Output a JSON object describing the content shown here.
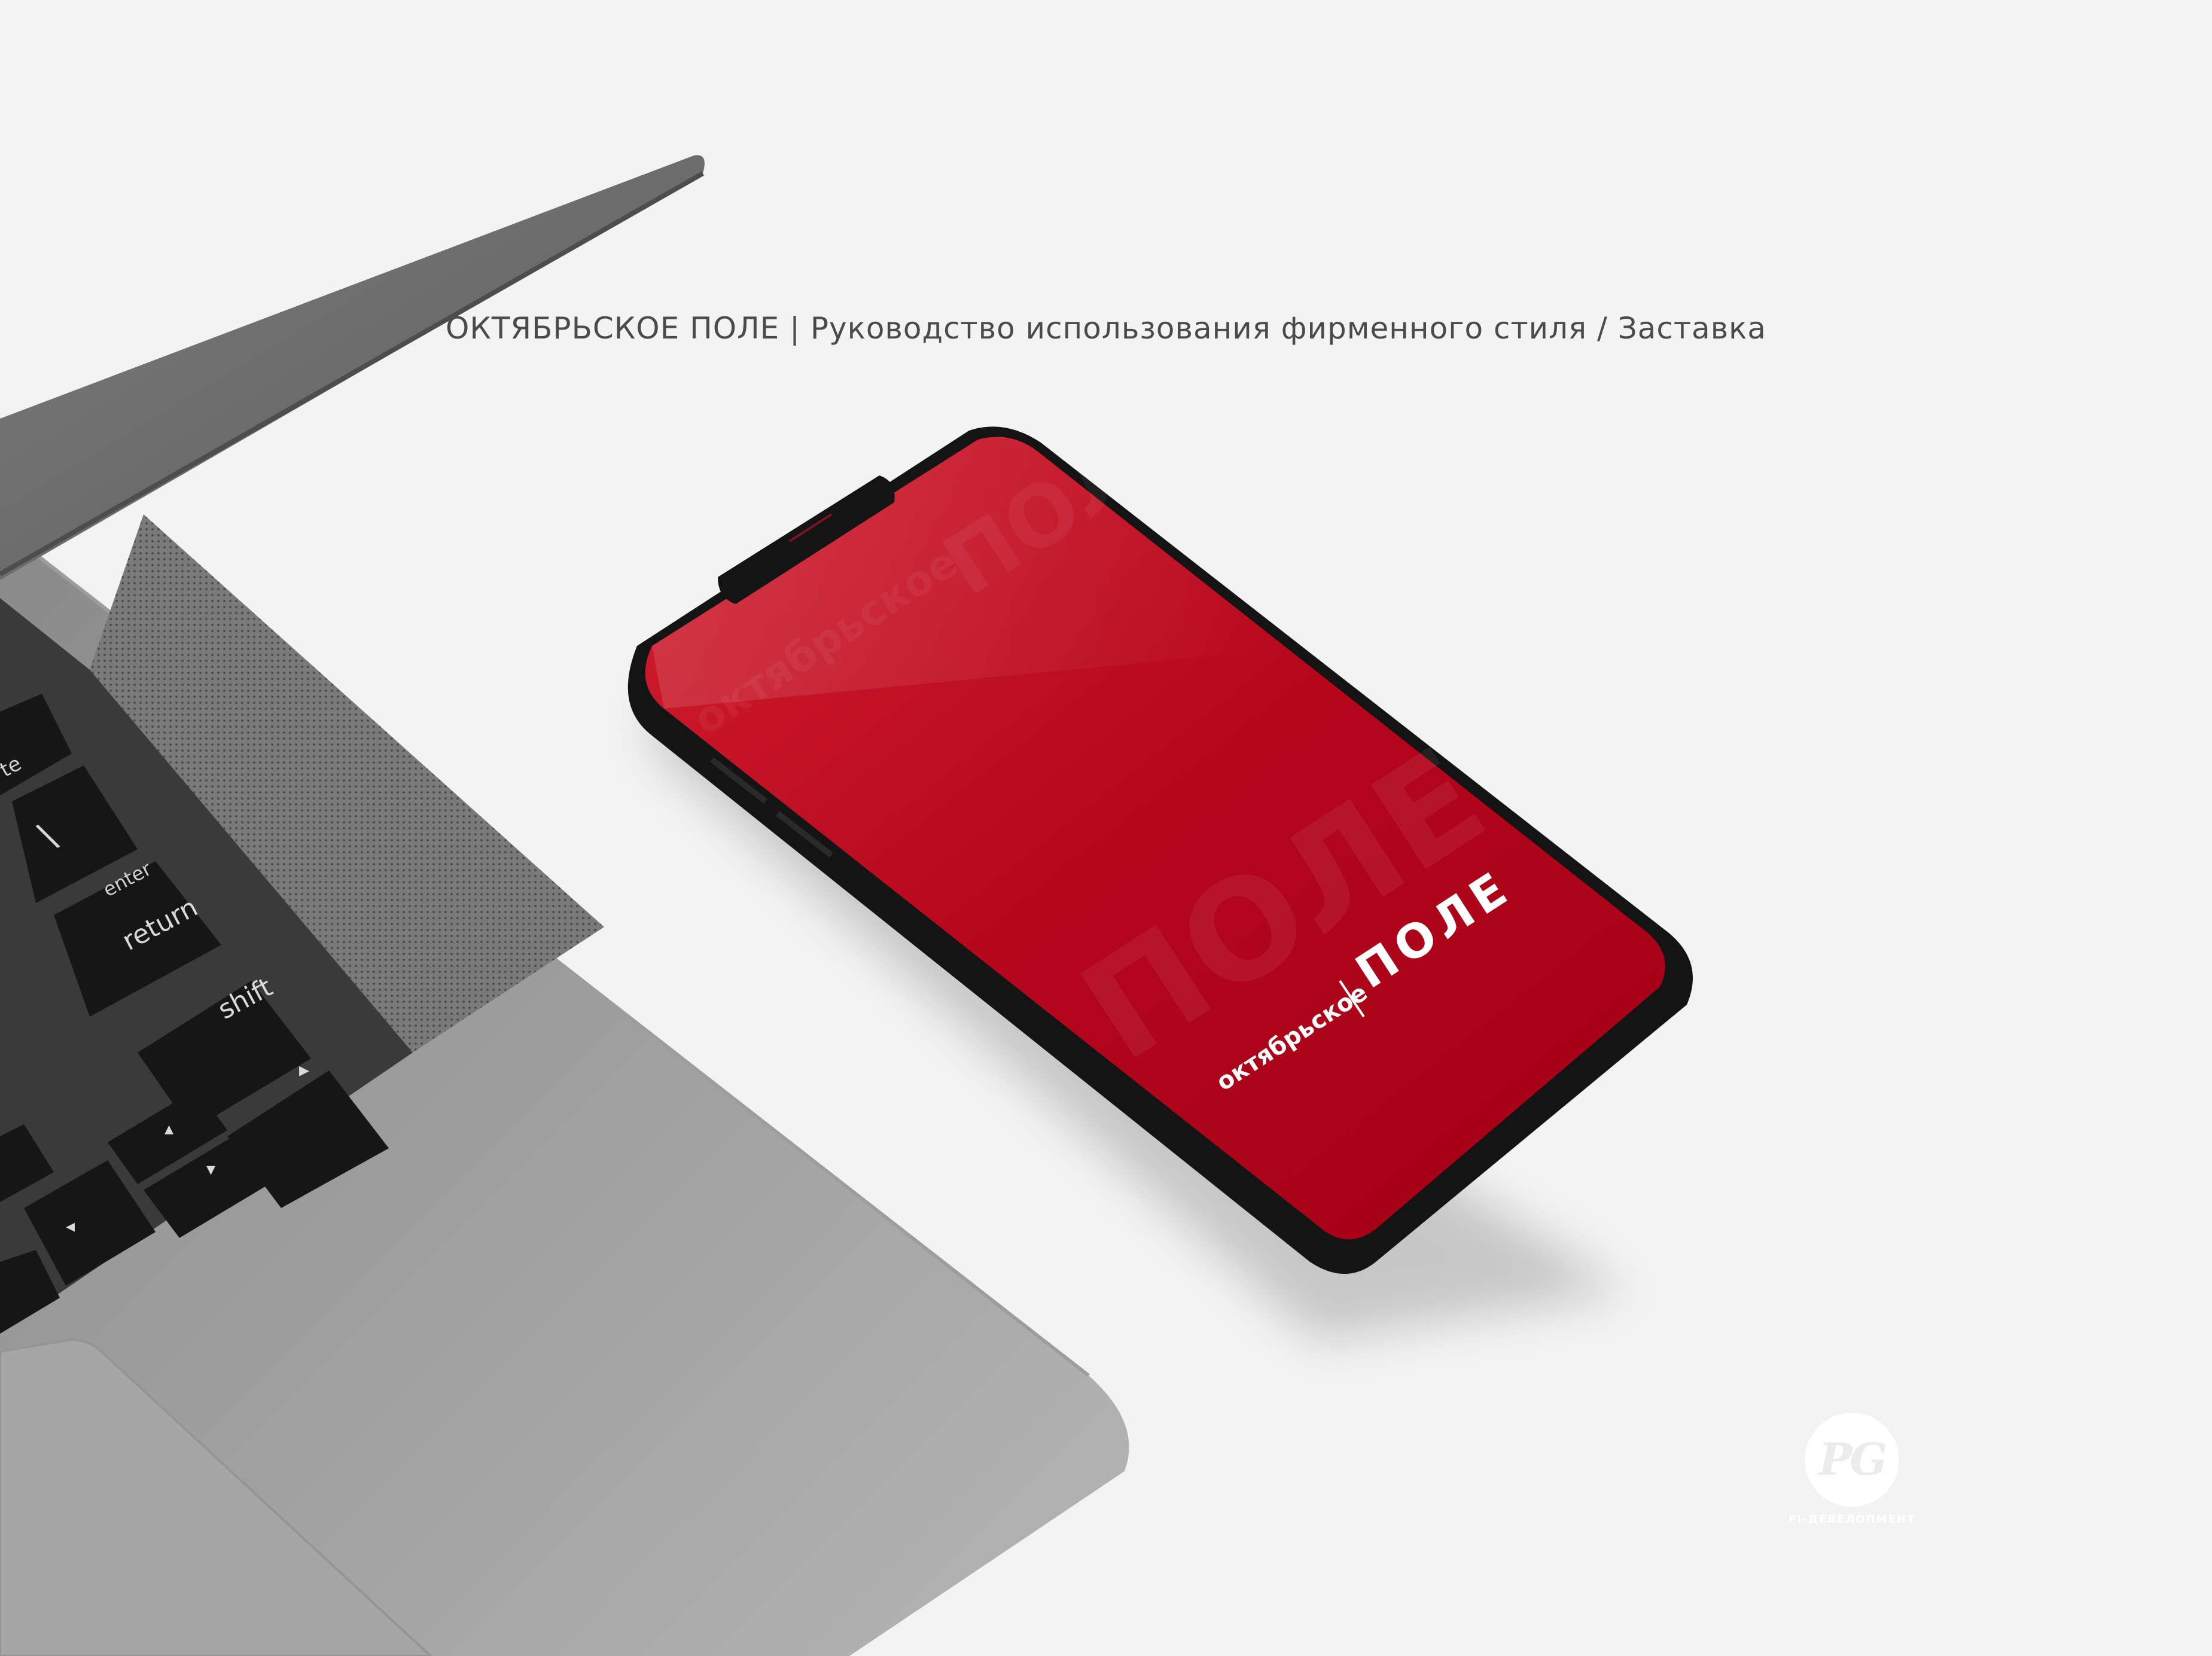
{
  "header": {
    "title": "ОКТЯБРЬСКОЕ ПОЛЕ | Руководство использования фирменного стиля / Заставка"
  },
  "phone": {
    "screen_color": "#c8102e",
    "brand_small": "октябрьское",
    "brand_large": "ПОЛЕ"
  },
  "laptop": {
    "keys": {
      "enter": "enter",
      "return": "return",
      "shift": "shift",
      "delete_partial": "te"
    }
  },
  "watermark": {
    "letters": "PG",
    "caption": "PI-ДЕВЕЛОПМЕНТ"
  },
  "colors": {
    "background": "#f3f3f3",
    "brand_red": "#c8102e",
    "laptop_gray": "#8a8a8a"
  }
}
